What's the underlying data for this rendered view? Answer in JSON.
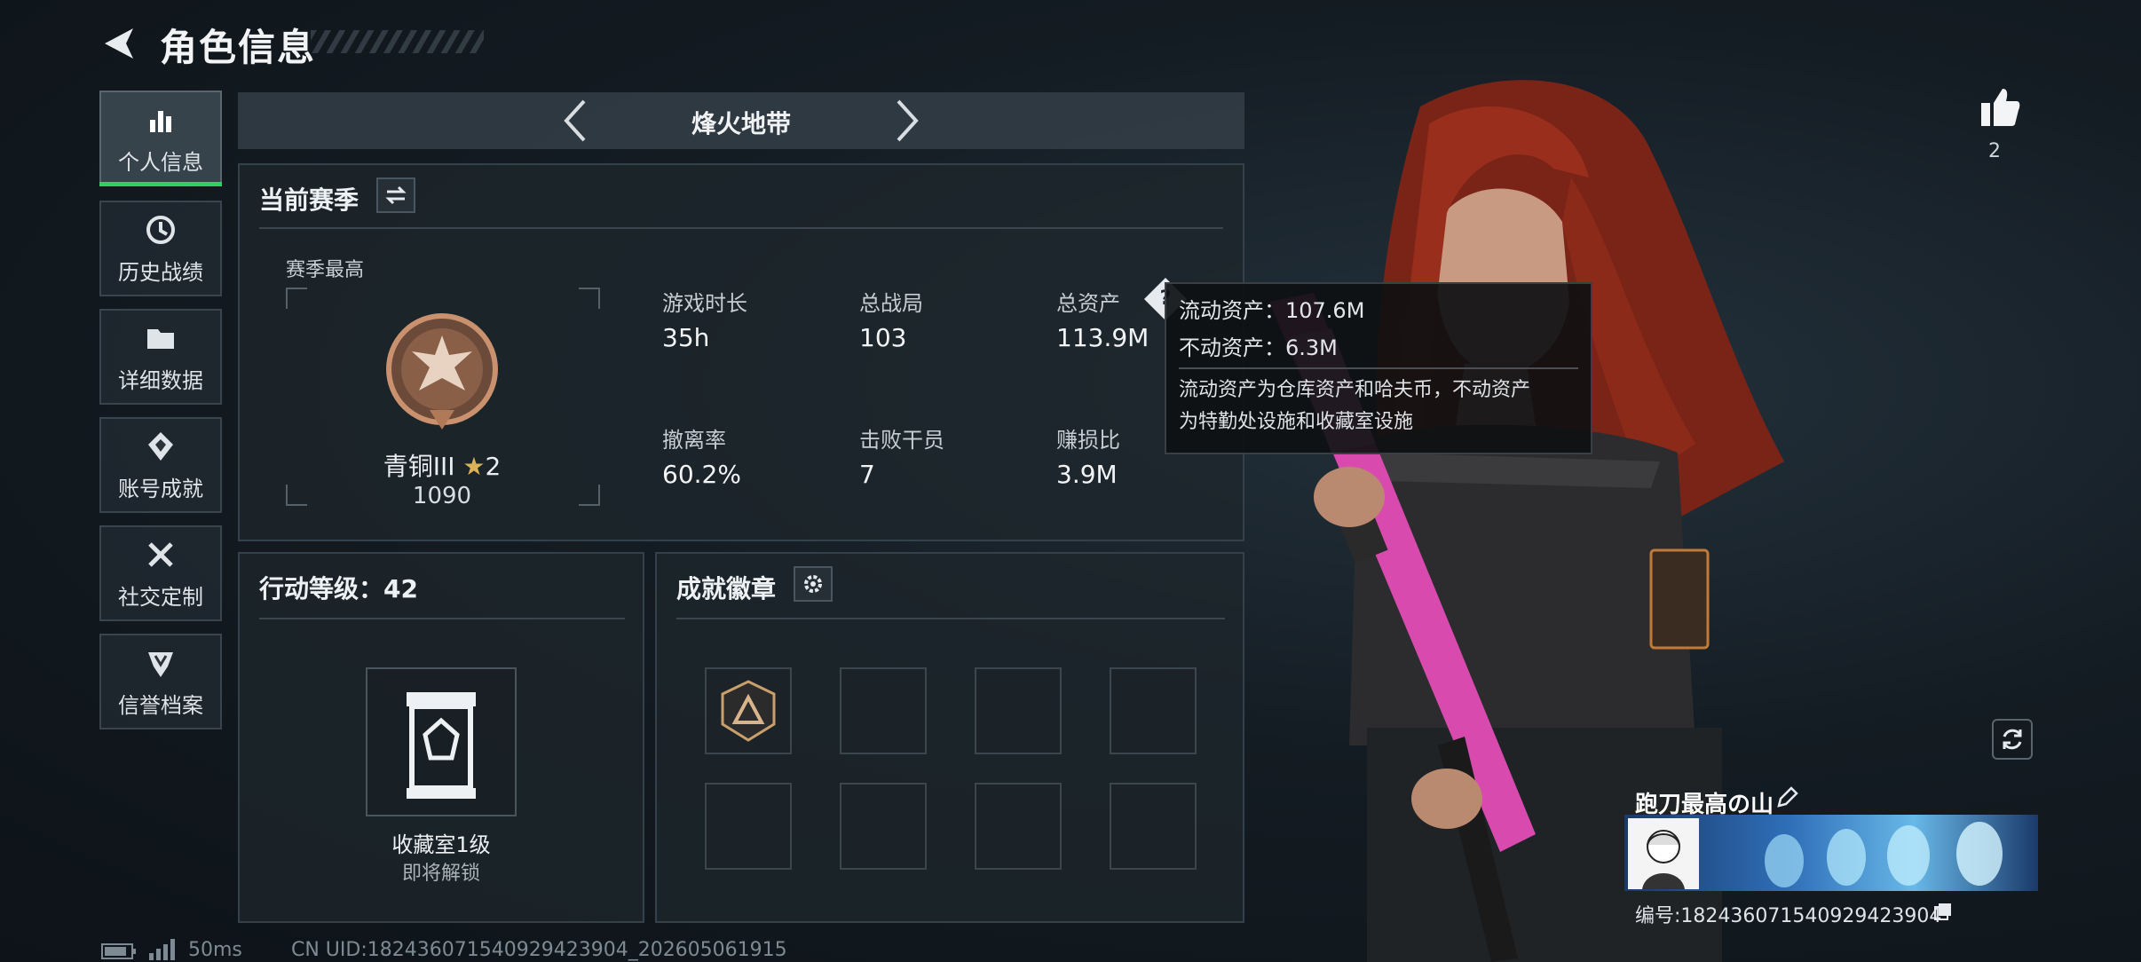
{
  "header": {
    "title": "角色信息"
  },
  "sidebar": {
    "items": [
      {
        "label": "个人信息",
        "icon": "bar-chart-icon",
        "active": true
      },
      {
        "label": "历史战绩",
        "icon": "history-clock-icon"
      },
      {
        "label": "详细数据",
        "icon": "folder-icon"
      },
      {
        "label": "账号成就",
        "icon": "achievement-icon"
      },
      {
        "label": "社交定制",
        "icon": "tools-icon"
      },
      {
        "label": "信誉档案",
        "icon": "credit-shield-icon"
      }
    ]
  },
  "mode": {
    "label": "烽火地带"
  },
  "season": {
    "title": "当前赛季",
    "best_label": "赛季最高",
    "rank_name": "青铜III",
    "rank_stars": "2",
    "rank_score": "1090",
    "stats": [
      {
        "label": "游戏时长",
        "value": "35h"
      },
      {
        "label": "总战局",
        "value": "103"
      },
      {
        "label": "总资产",
        "value": "113.9M"
      },
      {
        "label": "撤离率",
        "value": "60.2%"
      },
      {
        "label": "击败干员",
        "value": "7"
      },
      {
        "label": "赚损比",
        "value": "3.9M"
      }
    ]
  },
  "tooltip": {
    "line1": "流动资产：107.6M",
    "line2": "不动资产：6.3M",
    "note_line1": "流动资产为仓库资产和哈夫币，不动资产",
    "note_line2": "为特勤处设施和收藏室设施"
  },
  "level_panel": {
    "title": "行动等级：42",
    "collection_label": "收藏室1级",
    "collection_status": "即将解锁"
  },
  "badges": {
    "title": "成就徽章"
  },
  "profile": {
    "likes": "2",
    "player_name": "跑刀最高の山",
    "uid_label": "编号:182436071540929423904"
  },
  "status_bar": {
    "ping": "50ms",
    "uid_text": "CN UID:182436071540929423904_202605061915"
  },
  "colors": {
    "accent_green": "#2fd06a",
    "rank_bronze": "#b07a58",
    "weapon_pink": "#e054b8"
  }
}
